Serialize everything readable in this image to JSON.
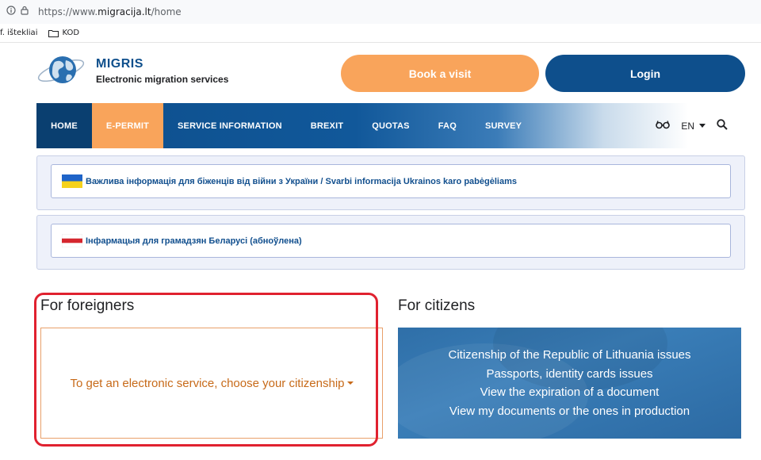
{
  "browser": {
    "url_prefix": "https://www.",
    "url_domain": "migracija.lt",
    "url_path": "/home",
    "bookmarks": [
      "f. ištekliai",
      "KOD"
    ]
  },
  "header": {
    "logo_title": "MIGRIS",
    "logo_subtitle": "Electronic migration services",
    "book_label": "Book a visit",
    "login_label": "Login"
  },
  "nav": {
    "items": [
      "HOME",
      "E-PERMIT",
      "SERVICE INFORMATION",
      "BREXIT",
      "QUOTAS",
      "FAQ",
      "SURVEY"
    ],
    "language": "EN"
  },
  "notices": [
    {
      "text": "Важлива інформація для біженців від війни з України / Svarbi informacija Ukrainos karo pabėgėliams",
      "flag": "ukraine"
    },
    {
      "text": "Інфармацыя для грамадзян Беларусі (абноўлена)",
      "flag": "belarus-white-red-white"
    }
  ],
  "foreigners": {
    "heading": "For foreigners",
    "select_label": "To get an electronic service, choose your citizenship"
  },
  "citizens": {
    "heading": "For citizens",
    "links": [
      "Citizenship of the Republic of Lithuania issues",
      "Passports, identity cards issues",
      "View the expiration of a document",
      "View my documents or the ones in production"
    ]
  },
  "colors": {
    "brand_blue": "#0e4f8c",
    "accent_orange": "#f9a45b",
    "highlight_red": "#e0212f"
  }
}
